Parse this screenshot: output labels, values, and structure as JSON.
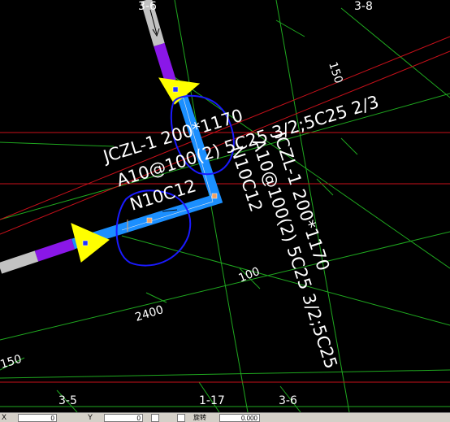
{
  "drawing": {
    "axis_labels": {
      "top_3_6": "3-6",
      "top_3_8": "3-8",
      "bottom_3_5": "3-5",
      "bottom_1_17": "1-17",
      "bottom_3_6": "3-6"
    },
    "beam_label_horizontal": {
      "line1": "JCZL-1 200*1170",
      "line2": "A10@100(2) 5C25 3/2;5C25 2/3",
      "line3": "N10C12"
    },
    "beam_label_vertical": {
      "line1": "JCZL-1 200*1170",
      "line2": "A10@100(2) 5C25 3/2;5C25",
      "line3": "N10C12"
    },
    "dimensions": {
      "d100": "100",
      "d2400": "2400",
      "d150_left": "150",
      "d150_top": "150"
    }
  },
  "status_bar": {
    "x_label": "X",
    "x_value": "0",
    "y_label": "Y",
    "y_value": "0",
    "rotate_label": "旋转",
    "rotate_value": "0.000"
  },
  "colors": {
    "grid_green": "#1fa81f",
    "axis_red": "#c8101a",
    "beam_blue": "#1b8fff",
    "beam_purple": "#8a17e8",
    "beam_gray": "#c2c2c2",
    "marker_yellow": "#ffff00",
    "annotation_circle": "#1a1aff"
  }
}
